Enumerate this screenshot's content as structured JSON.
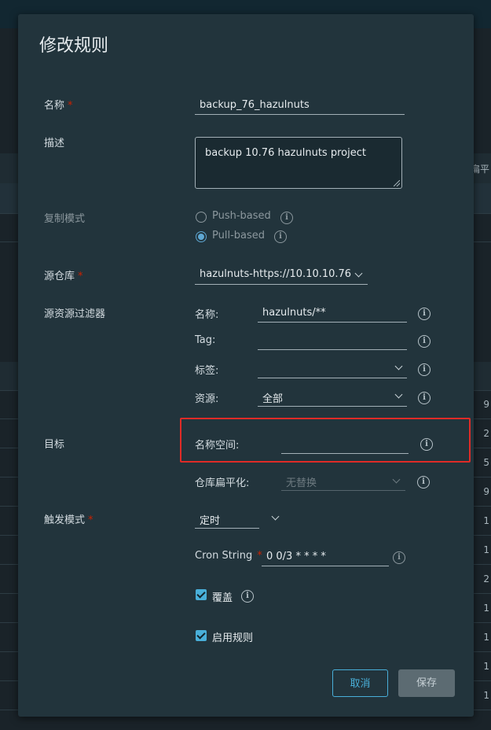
{
  "background": {
    "header_right": "扁平",
    "right_column_values": [
      "9",
      "2",
      "5",
      "9",
      "1",
      "1",
      "2",
      "1",
      "1",
      "1",
      "1"
    ]
  },
  "modal": {
    "title": "修改规则",
    "name": {
      "label": "名称",
      "required_mark": "*",
      "value": "backup_76_hazulnuts"
    },
    "description": {
      "label": "描述",
      "value": "backup 10.76  hazulnuts project"
    },
    "replication_mode": {
      "label": "复制模式",
      "options": [
        {
          "label": "Push-based",
          "checked": false
        },
        {
          "label": "Pull-based",
          "checked": true
        }
      ]
    },
    "source_registry": {
      "label": "源仓库",
      "required_mark": "*",
      "value": "hazulnuts-https://10.10.10.76"
    },
    "source_filter": {
      "label": "源资源过滤器",
      "name_label": "名称:",
      "name_value": "hazulnuts/**",
      "tag_label": "Tag:",
      "tag_value": "",
      "labels_label": "标签:",
      "labels_value": "",
      "resource_label": "资源:",
      "resource_value": "全部"
    },
    "destination": {
      "label": "目标",
      "namespace_label": "名称空间:",
      "namespace_value": "",
      "flatten_label": "仓库扁平化:",
      "flatten_value": "无替换"
    },
    "trigger": {
      "label": "触发模式",
      "required_mark": "*",
      "value": "定时",
      "cron_label": "Cron String",
      "cron_required": "*",
      "cron_value": "0 0/3 * * * *"
    },
    "override": {
      "label": "覆盖",
      "checked": true
    },
    "enable_rule": {
      "label": "启用规则",
      "checked": true
    },
    "buttons": {
      "cancel": "取消",
      "save": "保存"
    }
  },
  "colors": {
    "accent": "#49afd9",
    "required": "#c92100",
    "highlight_box": "#e02b27",
    "modal_bg": "#22343c"
  }
}
